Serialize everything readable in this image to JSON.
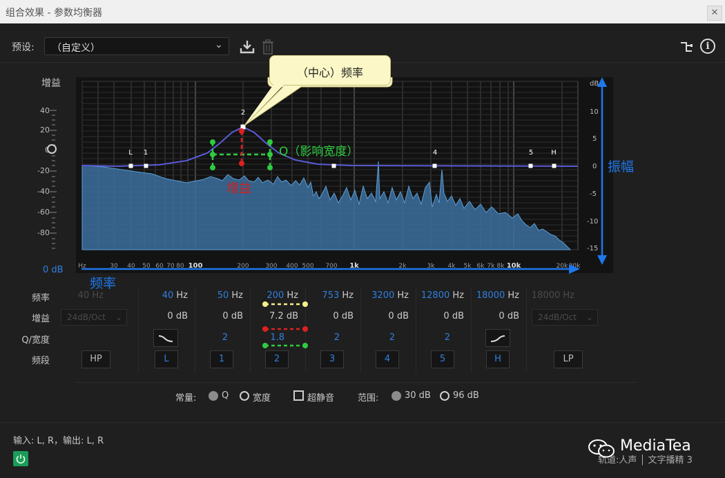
{
  "window": {
    "title": "组合效果 - 参数均衡器",
    "close_glyph": "✕"
  },
  "preset": {
    "label": "预设:",
    "value": "（自定义）",
    "chevron": "⌄"
  },
  "toolbar": {
    "save_icon": "download-icon",
    "delete_icon": "trash-icon",
    "routing_icon": "routing-icon",
    "info_label": "i"
  },
  "gain_slider": {
    "heading": "增益",
    "ticks": [
      "40",
      "20",
      "0",
      "-20",
      "-40",
      "-60",
      "-80"
    ],
    "value_label": "0 dB"
  },
  "graph": {
    "right_axis_unit": "dB",
    "right_ticks": [
      "10",
      "5",
      "0",
      "-5",
      "-10",
      "-15"
    ],
    "freq_ticks_major": [
      "100",
      "1k",
      "10k"
    ],
    "freq_ticks_minor": [
      "Hz",
      "30",
      "40",
      "50",
      "60",
      "70",
      "80",
      "200",
      "300",
      "400",
      "500",
      "700",
      "2k",
      "3k",
      "4k",
      "5k",
      "6k",
      "7k",
      "8k",
      "20k",
      "30k"
    ],
    "band_point_labels": [
      "L",
      "1",
      "2",
      "4",
      "5",
      "H"
    ],
    "callout": "（中心）频率",
    "q_annotation": "Q（影响宽度）",
    "gain_annotation": "增益",
    "amplitude_annotation": "振幅",
    "frequency_annotation": "频率"
  },
  "band_table": {
    "row_labels": {
      "frequency": "频率",
      "gain": "增益",
      "q": "Q/宽度",
      "band": "频段"
    },
    "hp": {
      "freq": "40 Hz",
      "slope": "24dB/Oct",
      "button": "HP"
    },
    "lp": {
      "freq": "18000 Hz",
      "slope": "24dB/Oct",
      "button": "LP"
    },
    "bands": [
      {
        "freq": "40",
        "unit": "Hz",
        "gain": "0 dB",
        "q": "",
        "button": "L"
      },
      {
        "freq": "50",
        "unit": "Hz",
        "gain": "0 dB",
        "q": "2",
        "button": "1"
      },
      {
        "freq": "200",
        "unit": "Hz",
        "gain": "7.2 dB",
        "q": "1.8",
        "button": "2"
      },
      {
        "freq": "753",
        "unit": "Hz",
        "gain": "0 dB",
        "q": "2",
        "button": "3"
      },
      {
        "freq": "3200",
        "unit": "Hz",
        "gain": "0 dB",
        "q": "2",
        "button": "4"
      },
      {
        "freq": "12800",
        "unit": "Hz",
        "gain": "0 dB",
        "q": "2",
        "button": "5"
      },
      {
        "freq": "18000",
        "unit": "Hz",
        "gain": "0 dB",
        "q": "",
        "button": "H"
      }
    ]
  },
  "options": {
    "constant_label": "常量:",
    "q_option": "Q",
    "width_option": "宽度",
    "ultra_quiet": "超静音",
    "range_label": "范围:",
    "range_30": "30 dB",
    "range_96": "96 dB"
  },
  "footer": {
    "io": "输入: L, R，输出: L, R",
    "track": "轨道:人声 │ 文字播精 3",
    "brand": "MediaTea"
  },
  "colors": {
    "accent": "#2f7fe0",
    "curve": "#5b5bd8",
    "spectrum": "#3f7bb3",
    "annotation_green": "#2ecc40",
    "annotation_red": "#e02020",
    "callout_bg": "#fbf7c6",
    "power": "#1c9b5a"
  }
}
